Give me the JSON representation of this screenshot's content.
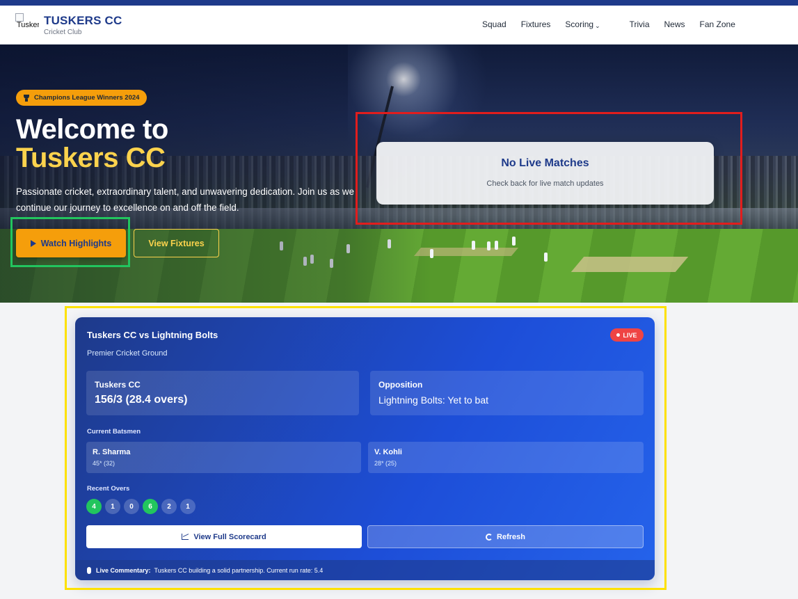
{
  "nav": {
    "logo_alt": "Tuskers CC",
    "brand": "TUSKERS CC",
    "brand_sub": "Cricket Club",
    "links": [
      "Squad",
      "Fixtures",
      "Scoring",
      "Trivia",
      "News",
      "Fan Zone"
    ]
  },
  "hero": {
    "badge": "Champions League Winners 2024",
    "heading_line1": "Welcome to",
    "heading_line2": "Tuskers CC",
    "lead": "Passionate cricket, extraordinary talent, and unwavering dedication. Join us as we continue our journey to excellence on and off the field.",
    "primary_button": "Watch Highlights",
    "secondary_button": "View Fixtures",
    "no_live_title": "No Live Matches",
    "no_live_sub": "Check back for live match updates"
  },
  "live_card": {
    "title": "Tuskers CC vs Lightning Bolts",
    "venue": "Premier Cricket Ground",
    "live_label": "LIVE",
    "team": {
      "name": "Tuskers CC",
      "score": "156/3 (28.4 overs)"
    },
    "opposition": {
      "label": "Opposition",
      "status": "Lightning Bolts: Yet to bat"
    },
    "batsmen_label": "Current Batsmen",
    "batsmen": [
      {
        "name": "R. Sharma",
        "stat": "45* (32)"
      },
      {
        "name": "V. Kohli",
        "stat": "28* (25)"
      }
    ],
    "recent_label": "Recent Overs",
    "recent_overs": [
      "4",
      "1",
      "0",
      "6",
      "2",
      "1"
    ],
    "scorecard_button": "View Full Scorecard",
    "refresh_button": "Refresh",
    "commentary_label": "Live Commentary:",
    "commentary_text": "Tuskers CC building a solid partnership. Current run rate: 5.4"
  },
  "colors": {
    "brand_blue": "#1e3a8a",
    "accent_amber": "#f59e0b",
    "highlight_yellow": "#fcd34d",
    "live_red": "#ef4444",
    "boundary_green": "#22c55e"
  }
}
